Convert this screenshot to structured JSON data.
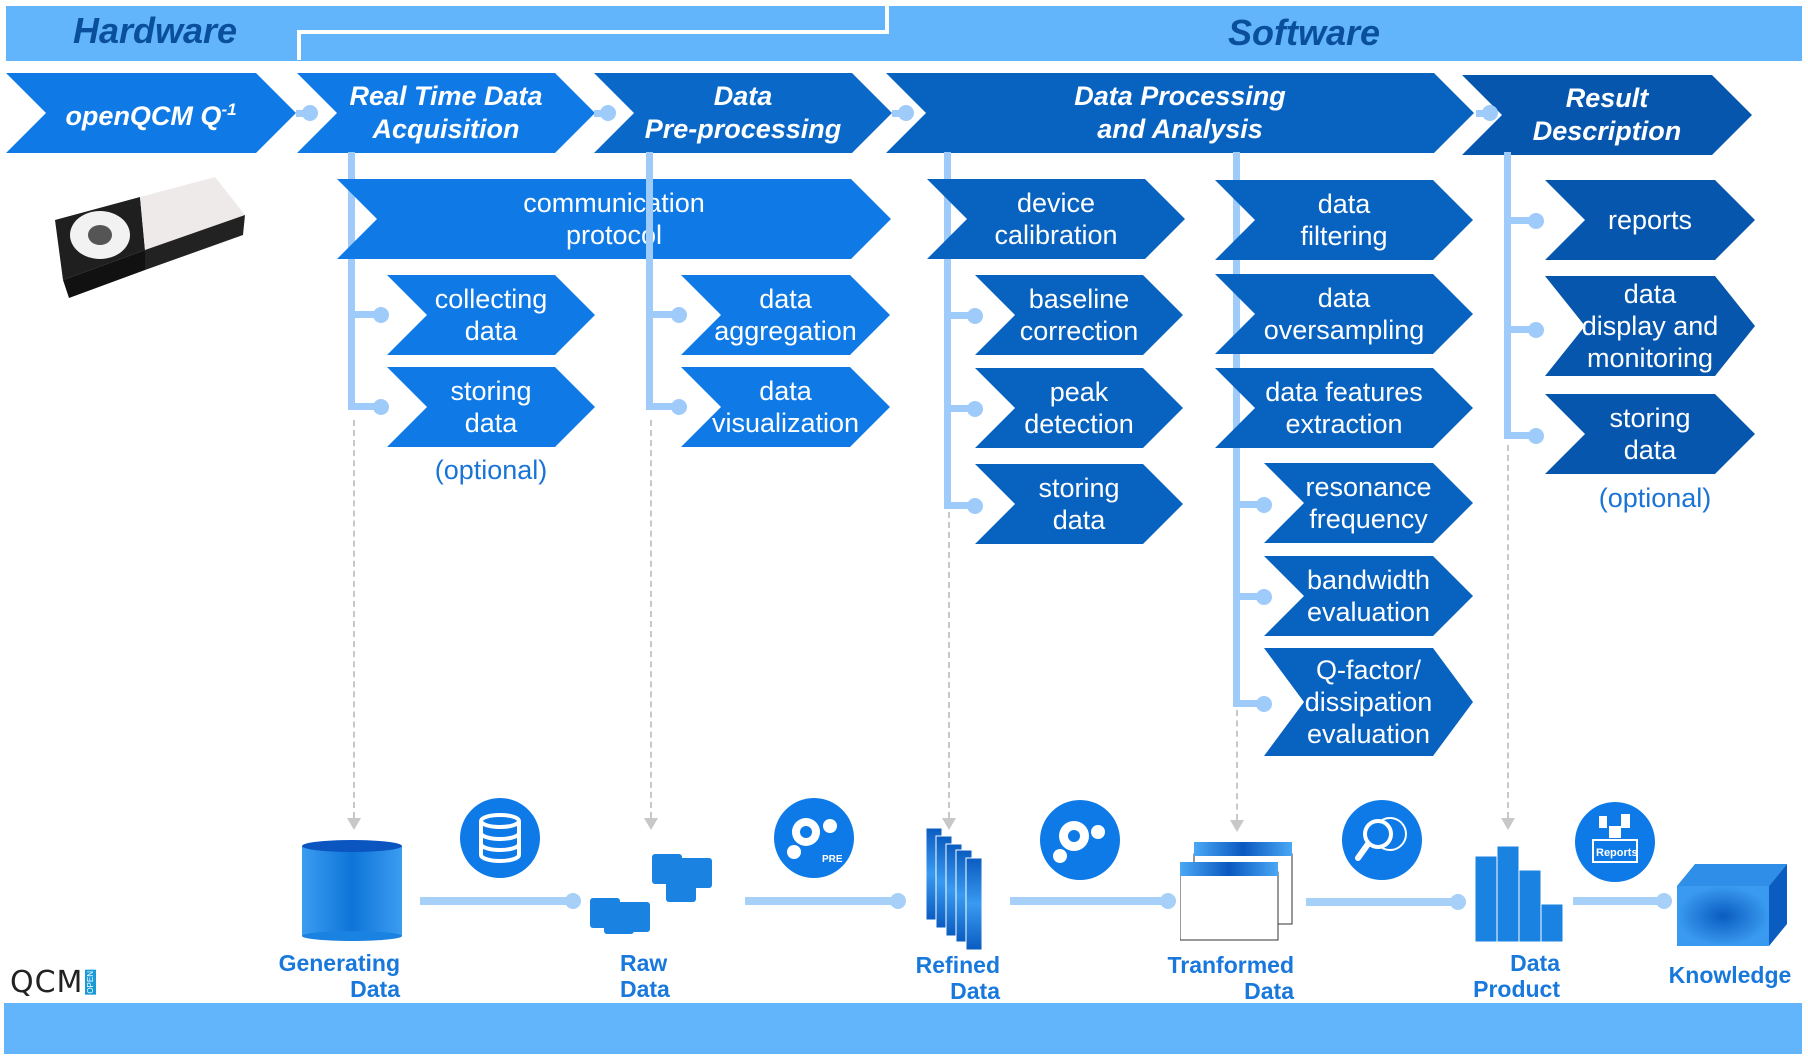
{
  "header": {
    "hardware_label": "Hardware",
    "software_label": "Software"
  },
  "stages": [
    {
      "id": "openqcm",
      "label": "openQCM Q",
      "superscript": "-1"
    },
    {
      "id": "acquisition",
      "label_line1": "Real Time Data",
      "label_line2": "Acquisition"
    },
    {
      "id": "preprocessing",
      "label_line1": "Data",
      "label_line2": "Pre-processing"
    },
    {
      "id": "processing",
      "label_line1": "Data Processing",
      "label_line2": "and Analysis"
    },
    {
      "id": "result",
      "label_line1": "Result",
      "label_line2": "Description"
    }
  ],
  "acquisition": {
    "protocol_line1": "communication",
    "protocol_line2": "protocol",
    "items": [
      {
        "line1": "collecting",
        "line2": "data"
      },
      {
        "line1": "storing",
        "line2": "data"
      }
    ],
    "note": "(optional)"
  },
  "preprocessing": {
    "items": [
      {
        "line1": "data",
        "line2": "aggregation"
      },
      {
        "line1": "data",
        "line2": "visualization"
      }
    ]
  },
  "processing": {
    "calibration": {
      "head": {
        "line1": "device",
        "line2": "calibration"
      },
      "items": [
        {
          "line1": "baseline",
          "line2": "correction"
        },
        {
          "line1": "peak",
          "line2": "detection"
        },
        {
          "line1": "storing",
          "line2": "data"
        }
      ]
    },
    "analysis": {
      "head": {
        "line1": "data",
        "line2": "filtering"
      },
      "mid": [
        {
          "line1": "data",
          "line2": "oversampling"
        },
        {
          "line1": "data features",
          "line2": "extraction"
        }
      ],
      "items": [
        {
          "line1": "resonance",
          "line2": "frequency"
        },
        {
          "line1": "bandwidth",
          "line2": "evaluation"
        },
        {
          "line1": "Q-factor/",
          "line2": "dissipation",
          "line3": "evaluation"
        }
      ]
    }
  },
  "result": {
    "items": [
      {
        "line1": "reports"
      },
      {
        "line1": "data",
        "line2": "display and",
        "line3": "monitoring"
      },
      {
        "line1": "storing",
        "line2": "data"
      }
    ],
    "note": "(optional)"
  },
  "pipeline": [
    {
      "line1": "Generating",
      "line2": "Data"
    },
    {
      "line1": "Raw",
      "line2": "Data"
    },
    {
      "line1": "Refined",
      "line2": "Data"
    },
    {
      "line1": "Tranformed",
      "line2": "Data"
    },
    {
      "line1": "Data",
      "line2": "Product"
    },
    {
      "line1": "Knowledge"
    }
  ],
  "process_icons": [
    {
      "icon": "database-icon"
    },
    {
      "icon": "gears-icon",
      "caption": "PRE"
    },
    {
      "icon": "gears-icon"
    },
    {
      "icon": "magnifier-globe-icon"
    },
    {
      "icon": "reports-box-icon",
      "caption": "Reports"
    }
  ],
  "logo": {
    "text": "QCM",
    "badge": "OPEN"
  },
  "colors": {
    "top_bar": "#63b5fb",
    "stage_light": "#0f7ae5",
    "stage_dark": "#0656ae",
    "connector": "#9ecbfa",
    "label_blue": "#1878dc"
  }
}
